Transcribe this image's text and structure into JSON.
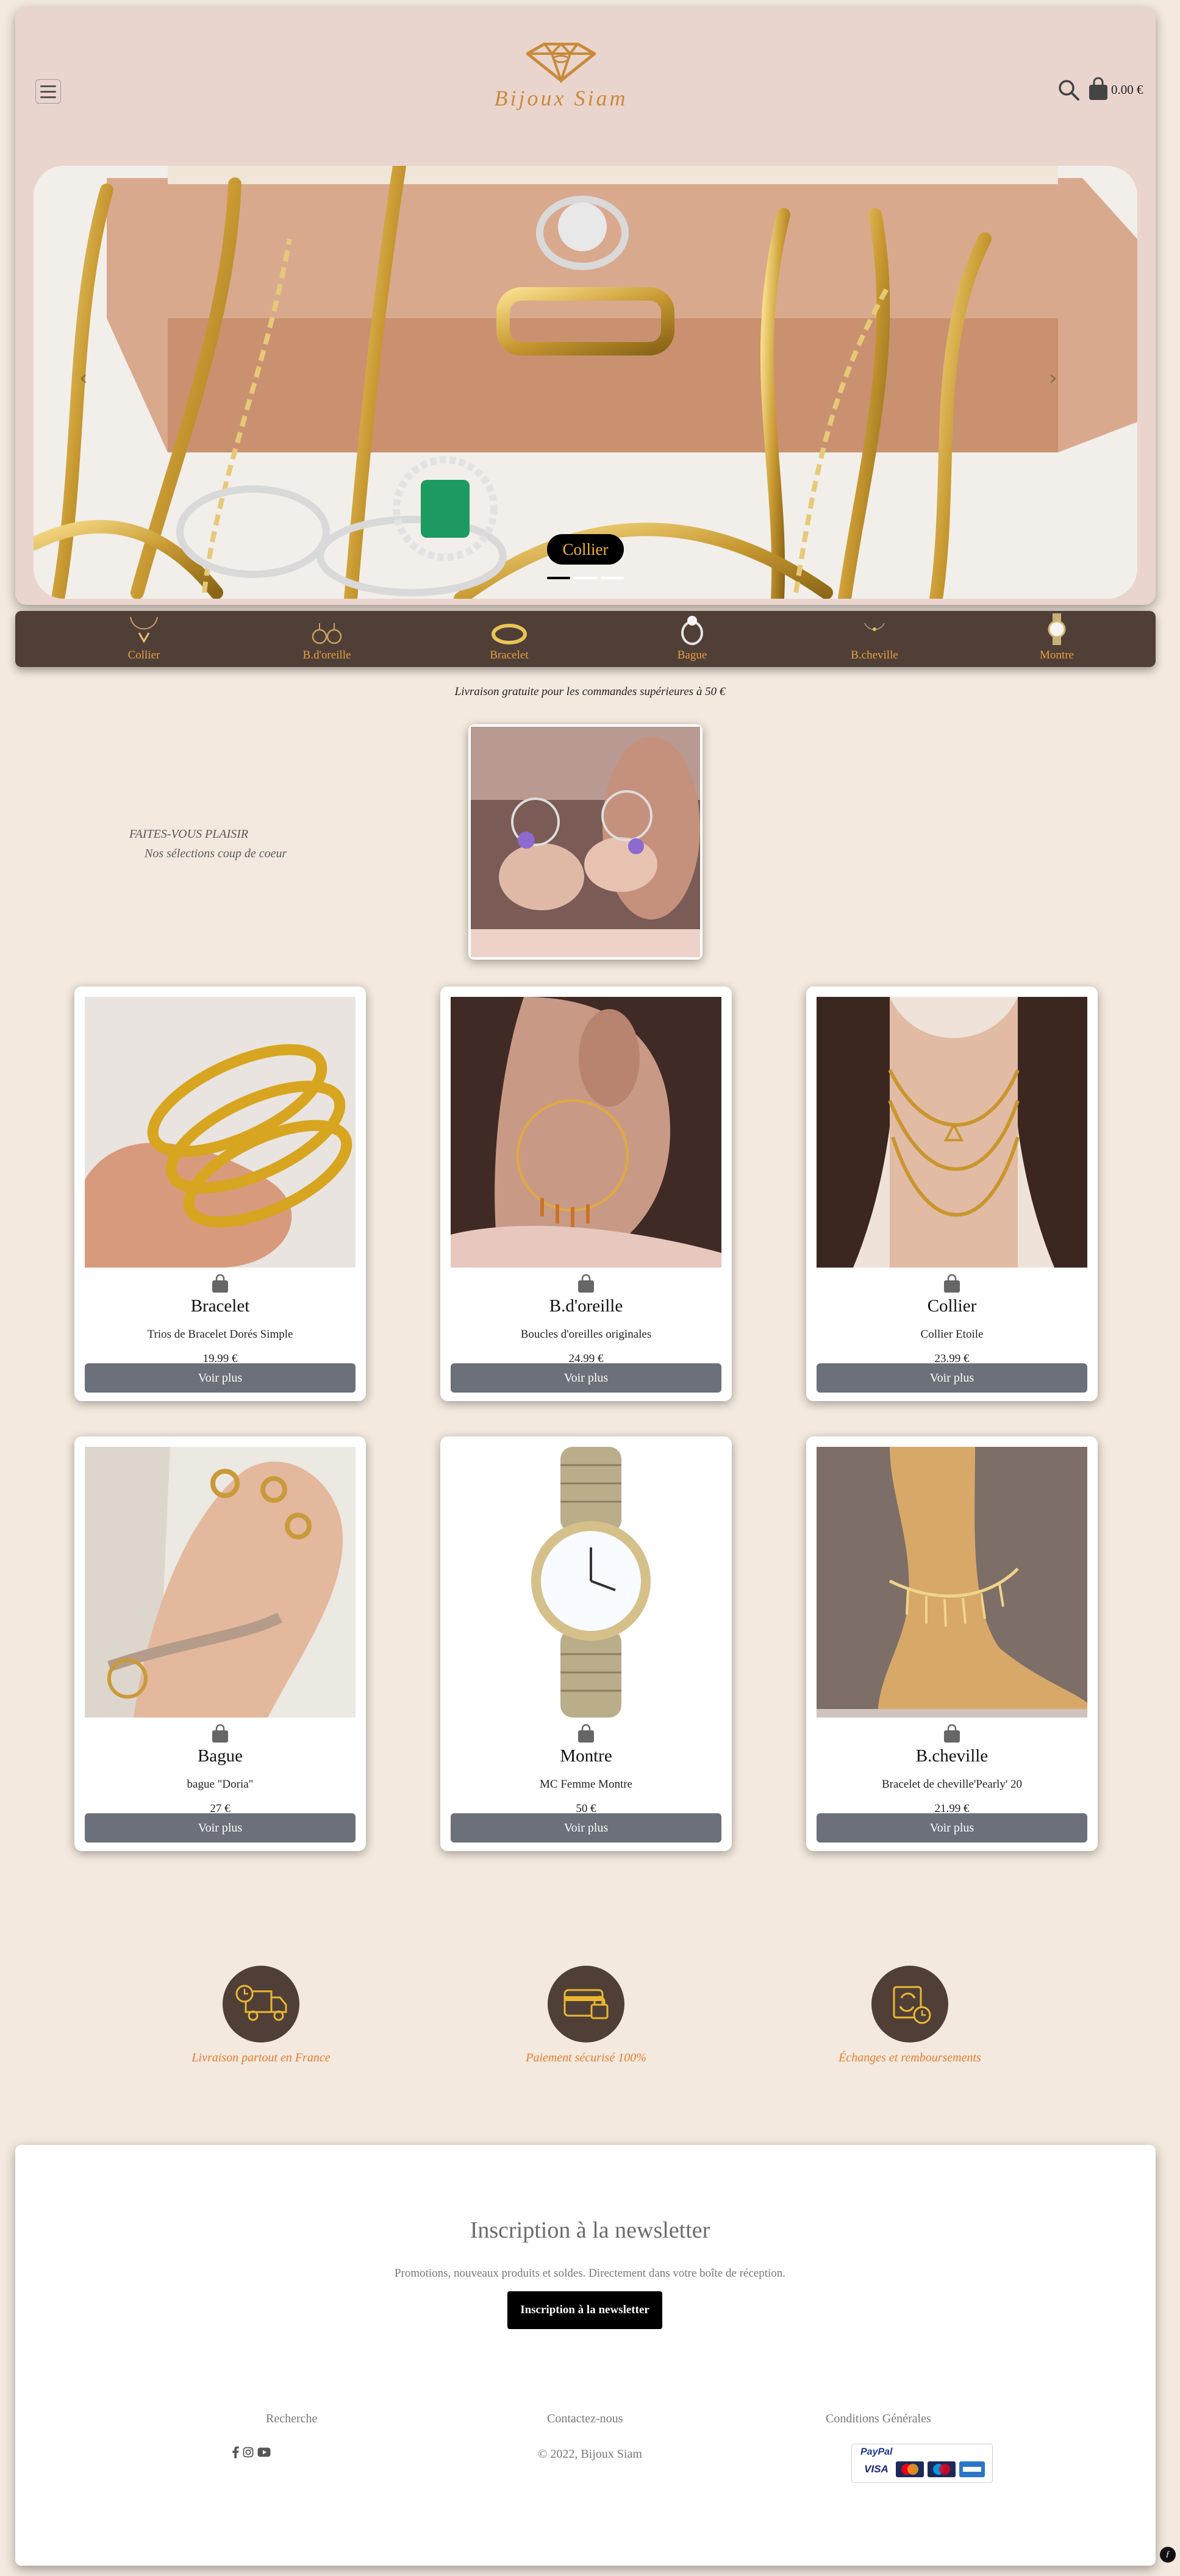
{
  "header": {
    "brand": "Bijoux Siam",
    "cart_total": "0.00 €"
  },
  "hero": {
    "caption": "Collier"
  },
  "categories": [
    {
      "label": "Collier",
      "icon": "necklace-icon"
    },
    {
      "label": "B.d'oreille",
      "icon": "earrings-icon"
    },
    {
      "label": "Bracelet",
      "icon": "bracelet-icon"
    },
    {
      "label": "Bague",
      "icon": "ring-icon"
    },
    {
      "label": "B.cheville",
      "icon": "anklet-icon"
    },
    {
      "label": "Montre",
      "icon": "watch-icon"
    }
  ],
  "shipping_note": "Livraison gratuite pour les commandes supérieures à 50 €",
  "featured": {
    "heading": "FAITES-VOUS PLAISIR",
    "subheading": "Nos sélections coup de coeur"
  },
  "products": [
    {
      "category": "Bracelet",
      "name": "Trios de Bracelet Dorés Simple",
      "price": "19.99 €",
      "button": "Voir plus"
    },
    {
      "category": "B.d'oreille",
      "name": "Boucles d'oreilles originales",
      "price": "24.99 €",
      "button": "Voir plus"
    },
    {
      "category": "Collier",
      "name": "Collier Etoile",
      "price": "23.99 €",
      "button": "Voir plus"
    },
    {
      "category": "Bague",
      "name": "bague \"Doria\"",
      "price": "27 €",
      "button": "Voir plus"
    },
    {
      "category": "Montre",
      "name": "MC Femme Montre",
      "price": "50 €",
      "button": "Voir plus"
    },
    {
      "category": "B.cheville",
      "name": "Bracelet de cheville'Pearly' 20",
      "price": "21.99 €",
      "button": "Voir plus"
    }
  ],
  "features": [
    {
      "text": "Livraison partout en France",
      "icon": "delivery-truck-icon"
    },
    {
      "text": "Paiement sécurisé 100%",
      "icon": "secure-payment-icon"
    },
    {
      "text": "Échanges et remboursements",
      "icon": "exchange-refund-icon"
    }
  ],
  "newsletter": {
    "title": "Inscription à la newsletter",
    "subtitle": "Promotions, nouveaux produits et soldes. Directement dans votre boîte de réception.",
    "button": "Inscription à la newsletter"
  },
  "footer": {
    "link_search": "Recherche",
    "link_contact": "Contactez-nous",
    "link_terms": "Conditions Générales",
    "copyright": "2022, Bijoux Siam",
    "payment_paypal": "PayPal",
    "payment_visa": "VISA"
  },
  "colors": {
    "page_bg": "#f3e9de",
    "header_bg": "#ead5ce",
    "category_bar": "#4f3f37",
    "gold_accent": "#e8a043",
    "feature_text": "#e77a2c",
    "button_grey": "#6b7079"
  }
}
